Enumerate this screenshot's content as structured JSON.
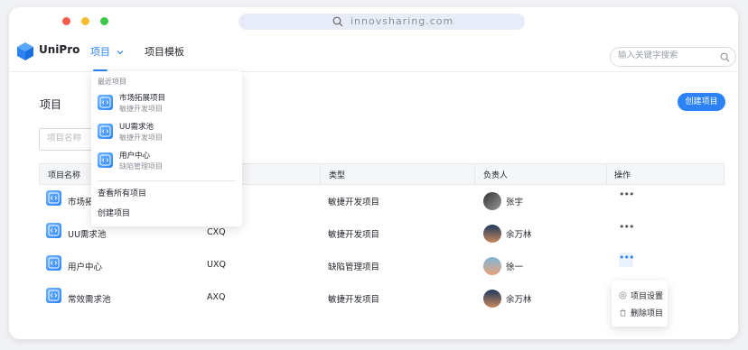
{
  "browser": {
    "url": "innovsharing.com"
  },
  "nav": {
    "brand": "UniPro",
    "project_label": "项目",
    "template_label": "项目模板",
    "search_placeholder": "输入关键字搜索"
  },
  "dropdown": {
    "header": "最近项目",
    "items": [
      {
        "name": "市场拓展项目",
        "type": "敏捷开发项目"
      },
      {
        "name": "UU需求池",
        "type": "敏捷开发项目"
      },
      {
        "name": "用户中心",
        "type": "缺陷管理项目"
      }
    ],
    "view_all": "查看所有项目",
    "create": "创建项目"
  },
  "page": {
    "title": "项目",
    "create_button": "创建项目",
    "name_filter_placeholder": "项目名称"
  },
  "table": {
    "headers": [
      "项目名称",
      "",
      "类型",
      "负责人",
      "操作"
    ],
    "rows": [
      {
        "name": "市场拓",
        "key": "",
        "type": "敏捷开发项目",
        "owner": "张宇"
      },
      {
        "name": "UU需求池",
        "key": "CXQ",
        "type": "敏捷开发项目",
        "owner": "余万林"
      },
      {
        "name": "用户中心",
        "key": "UXQ",
        "type": "缺陷管理项目",
        "owner": "徐一"
      },
      {
        "name": "常效需求池",
        "key": "AXQ",
        "type": "敏捷开发项目",
        "owner": "余万林"
      }
    ]
  },
  "row_menu": {
    "settings": "项目设置",
    "delete": "删除项目"
  },
  "colors": {
    "accent": "#2b83f6"
  }
}
